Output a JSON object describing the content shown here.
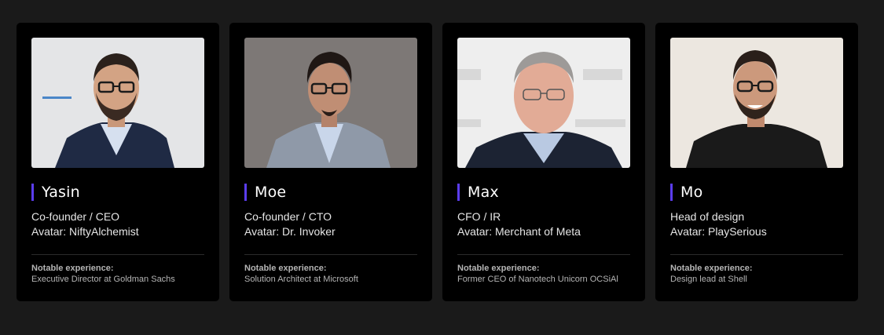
{
  "team": [
    {
      "name": "Yasin",
      "role": "Co-founder / CEO",
      "avatar": "Avatar: NiftyAlchemist",
      "experience_label": "Notable experience:",
      "experience": "Executive Director at Goldman Sachs",
      "photo_icon": "portrait-photo"
    },
    {
      "name": "Moe",
      "role": "Co-founder / CTO",
      "avatar": "Avatar: Dr. Invoker",
      "experience_label": "Notable experience:",
      "experience": "Solution Architect at Microsoft",
      "photo_icon": "portrait-photo"
    },
    {
      "name": "Max",
      "role": "CFO / IR",
      "avatar": "Avatar: Merchant of Meta",
      "experience_label": "Notable experience:",
      "experience": "Former CEO of Nanotech Unicorn OCSiAl",
      "photo_icon": "portrait-photo"
    },
    {
      "name": "Mo",
      "role": "Head of design",
      "avatar": "Avatar: PlaySerious",
      "experience_label": "Notable experience:",
      "experience": "Design lead at Shell",
      "photo_icon": "portrait-photo"
    }
  ],
  "colors": {
    "page_bg": "#1a1a1a",
    "card_bg": "#000000",
    "accent": "#5b3df0"
  }
}
